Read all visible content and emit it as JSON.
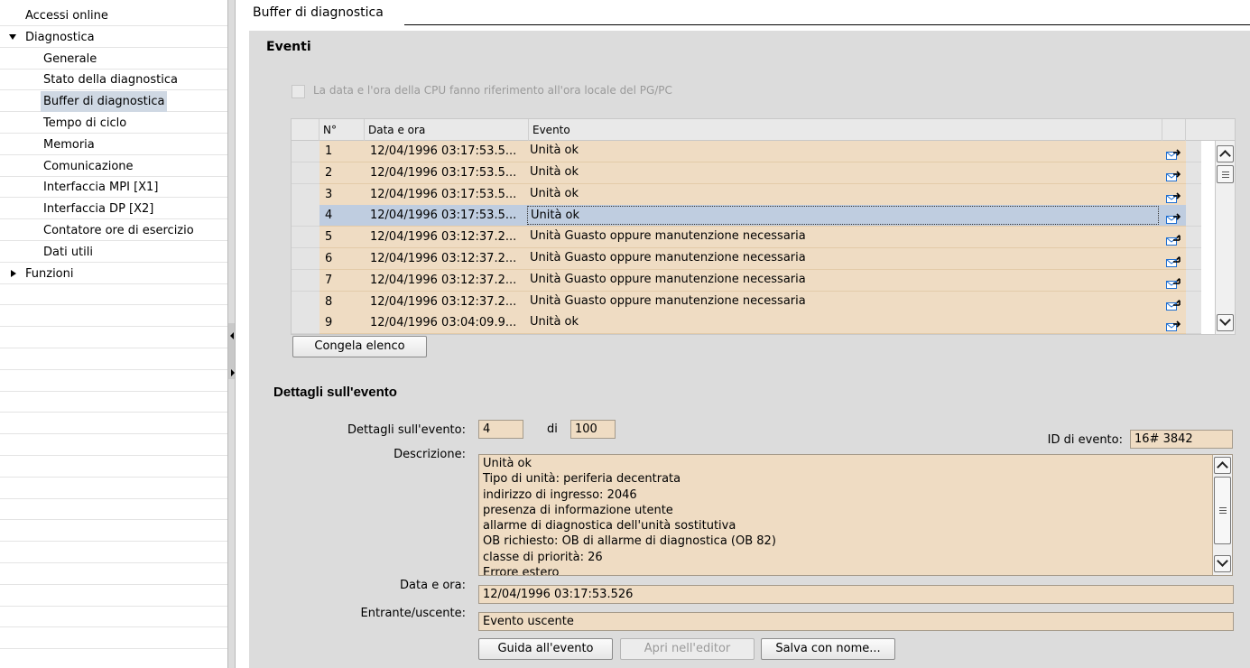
{
  "sidebar": {
    "items": [
      {
        "label": "Accessi online",
        "level": 0,
        "expander": "none"
      },
      {
        "label": "Diagnostica",
        "level": 0,
        "expander": "expanded"
      },
      {
        "label": "Generale",
        "level": 1
      },
      {
        "label": "Stato della diagnostica",
        "level": 1
      },
      {
        "label": "Buffer di diagnostica",
        "level": 1,
        "selected": true
      },
      {
        "label": "Tempo di ciclo",
        "level": 1
      },
      {
        "label": "Memoria",
        "level": 1
      },
      {
        "label": "Comunicazione",
        "level": 1
      },
      {
        "label": "Interfaccia MPI [X1]",
        "level": 1
      },
      {
        "label": "Interfaccia DP [X2]",
        "level": 1
      },
      {
        "label": "Contatore ore di esercizio",
        "level": 1
      },
      {
        "label": "Dati utili",
        "level": 1
      },
      {
        "label": "Funzioni",
        "level": 0,
        "expander": "collapsed"
      }
    ]
  },
  "tab": {
    "title": "Buffer di diagnostica"
  },
  "events": {
    "title": "Eventi",
    "checkbox_label": "La data e l'ora della CPU fanno riferimento all'ora locale del PG/PC",
    "checkbox_checked": false,
    "columns": [
      "N°",
      "Data e ora",
      "Evento"
    ],
    "rows": [
      {
        "n": "1",
        "datetime": "12/04/1996 03:17:53.5...",
        "event": "Unità ok",
        "direction": "outgoing"
      },
      {
        "n": "2",
        "datetime": "12/04/1996 03:17:53.5...",
        "event": "Unità ok",
        "direction": "outgoing"
      },
      {
        "n": "3",
        "datetime": "12/04/1996 03:17:53.5...",
        "event": "Unità ok",
        "direction": "outgoing"
      },
      {
        "n": "4",
        "datetime": "12/04/1996 03:17:53.5...",
        "event": "Unità ok",
        "direction": "outgoing",
        "selected": true
      },
      {
        "n": "5",
        "datetime": "12/04/1996 03:12:37.2...",
        "event": "Unità Guasto oppure manutenzione necessaria",
        "direction": "incoming"
      },
      {
        "n": "6",
        "datetime": "12/04/1996 03:12:37.2...",
        "event": "Unità Guasto oppure manutenzione necessaria",
        "direction": "incoming"
      },
      {
        "n": "7",
        "datetime": "12/04/1996 03:12:37.2...",
        "event": "Unità Guasto oppure manutenzione necessaria",
        "direction": "incoming"
      },
      {
        "n": "8",
        "datetime": "12/04/1996 03:12:37.2...",
        "event": "Unità Guasto oppure manutenzione necessaria",
        "direction": "incoming"
      },
      {
        "n": "9",
        "datetime": "12/04/1996 03:04:09.9...",
        "event": "Unità ok",
        "direction": "outgoing"
      }
    ],
    "freeze_button": "Congela elenco"
  },
  "details": {
    "title": "Dettagli sull'evento",
    "event_label": "Dettagli sull'evento:",
    "event_index": "4",
    "of_label": "di",
    "event_total": "100",
    "event_id_label": "ID di evento:",
    "event_id": "16# 3842",
    "description_label": "Descrizione:",
    "description_lines": [
      "Unità ok",
      "Tipo di unità: periferia decentrata",
      "indirizzo di ingresso:  2046",
      "presenza di informazione utente",
      "allarme di diagnostica dell'unità sostitutiva",
      "OB richiesto: OB di allarme di diagnostica (OB 82)",
      "classe di priorità: 26",
      "Errore estero"
    ],
    "datetime_label": "Data e ora:",
    "datetime_value": "12/04/1996 03:17:53.526",
    "direction_label": "Entrante/uscente:",
    "direction_value": "Evento uscente",
    "buttons": {
      "help": "Guida all'evento",
      "open_editor": "Apri nell'editor",
      "save_as": "Salva con nome..."
    }
  },
  "colors": {
    "row_bg": "#efdcc3",
    "row_selected_bg": "#bfcde0",
    "panel_bg": "#dcdcdc",
    "icon_blue": "#1f6fd1"
  }
}
